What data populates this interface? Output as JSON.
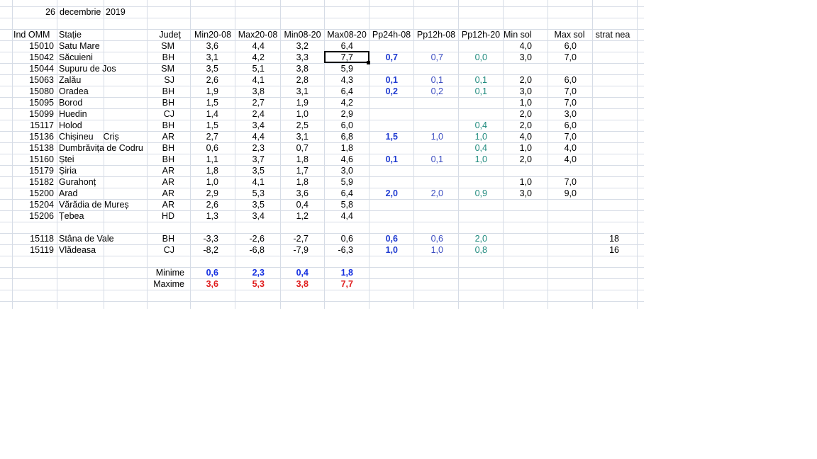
{
  "date": {
    "day": "26",
    "month": "decembrie",
    "year": "2019"
  },
  "headers": [
    "Ind OMM",
    "Stație",
    "Județ",
    "Min20-08",
    "Max20-08",
    "Min08-20",
    "Max08-20",
    "Pp24h-08",
    "Pp12h-08",
    "Pp12h-20",
    "Min sol",
    "Max sol",
    "strat nea"
  ],
  "rows": [
    {
      "id": "15010",
      "station": "Satu Mare",
      "county": "SM",
      "min2008": "3,6",
      "max2008": "4,4",
      "min0820": "3,2",
      "max0820": "6,4",
      "pp24": "",
      "pp12a": "",
      "pp12b": "",
      "minsol": "4,0",
      "maxsol": "6,0",
      "snow": ""
    },
    {
      "id": "15042",
      "station": "Săcuieni",
      "county": "BH",
      "min2008": "3,1",
      "max2008": "4,2",
      "min0820": "3,3",
      "max0820": "7,7",
      "pp24": "0,7",
      "pp12a": "0,7",
      "pp12b": "0,0",
      "minsol": "3,0",
      "maxsol": "7,0",
      "snow": ""
    },
    {
      "id": "15044",
      "station": "Supuru de Jos",
      "county": "SM",
      "min2008": "3,5",
      "max2008": "5,1",
      "min0820": "3,8",
      "max0820": "5,9",
      "pp24": "",
      "pp12a": "",
      "pp12b": "",
      "minsol": "",
      "maxsol": "",
      "snow": ""
    },
    {
      "id": "15063",
      "station": "Zalău",
      "county": "SJ",
      "min2008": "2,6",
      "max2008": "4,1",
      "min0820": "2,8",
      "max0820": "4,3",
      "pp24": "0,1",
      "pp12a": "0,1",
      "pp12b": "0,1",
      "minsol": "2,0",
      "maxsol": "6,0",
      "snow": ""
    },
    {
      "id": "15080",
      "station": "Oradea",
      "county": "BH",
      "min2008": "1,9",
      "max2008": "3,8",
      "min0820": "3,1",
      "max0820": "6,4",
      "pp24": "0,2",
      "pp12a": "0,2",
      "pp12b": "0,1",
      "minsol": "3,0",
      "maxsol": "7,0",
      "snow": ""
    },
    {
      "id": "15095",
      "station": "Borod",
      "county": "BH",
      "min2008": "1,5",
      "max2008": "2,7",
      "min0820": "1,9",
      "max0820": "4,2",
      "pp24": "",
      "pp12a": "",
      "pp12b": "",
      "minsol": "1,0",
      "maxsol": "7,0",
      "snow": ""
    },
    {
      "id": "15099",
      "station": "Huedin",
      "county": "CJ",
      "min2008": "1,4",
      "max2008": "2,4",
      "min0820": "1,0",
      "max0820": "2,9",
      "pp24": "",
      "pp12a": "",
      "pp12b": "",
      "minsol": "2,0",
      "maxsol": "3,0",
      "snow": ""
    },
    {
      "id": "15117",
      "station": "Holod",
      "county": "BH",
      "min2008": "1,5",
      "max2008": "3,4",
      "min0820": "2,5",
      "max0820": "6,0",
      "pp24": "",
      "pp12a": "",
      "pp12b": "0,4",
      "minsol": "2,0",
      "maxsol": "6,0",
      "snow": ""
    },
    {
      "id": "15136",
      "station": "Chișineu    Criș",
      "county": "AR",
      "min2008": "2,7",
      "max2008": "4,4",
      "min0820": "3,1",
      "max0820": "6,8",
      "pp24": "1,5",
      "pp12a": "1,0",
      "pp12b": "1,0",
      "minsol": "4,0",
      "maxsol": "7,0",
      "snow": ""
    },
    {
      "id": "15138",
      "station": "Dumbrăvița de Codru",
      "county": "BH",
      "min2008": "0,6",
      "max2008": "2,3",
      "min0820": "0,7",
      "max0820": "1,8",
      "pp24": "",
      "pp12a": "",
      "pp12b": "0,4",
      "minsol": "1,0",
      "maxsol": "4,0",
      "snow": ""
    },
    {
      "id": "15160",
      "station": "Ștei",
      "county": "BH",
      "min2008": "1,1",
      "max2008": "3,7",
      "min0820": "1,8",
      "max0820": "4,6",
      "pp24": "0,1",
      "pp12a": "0,1",
      "pp12b": "1,0",
      "minsol": "2,0",
      "maxsol": "4,0",
      "snow": ""
    },
    {
      "id": "15179",
      "station": "Șiria",
      "county": "AR",
      "min2008": "1,8",
      "max2008": "3,5",
      "min0820": "1,7",
      "max0820": "3,0",
      "pp24": "",
      "pp12a": "",
      "pp12b": "",
      "minsol": "",
      "maxsol": "",
      "snow": ""
    },
    {
      "id": "15182",
      "station": "Gurahonț",
      "county": "AR",
      "min2008": "1,0",
      "max2008": "4,1",
      "min0820": "1,8",
      "max0820": "5,9",
      "pp24": "",
      "pp12a": "",
      "pp12b": "",
      "minsol": "1,0",
      "maxsol": "7,0",
      "snow": ""
    },
    {
      "id": "15200",
      "station": "Arad",
      "county": "AR",
      "min2008": "2,9",
      "max2008": "5,3",
      "min0820": "3,6",
      "max0820": "6,4",
      "pp24": "2,0",
      "pp12a": "2,0",
      "pp12b": "0,9",
      "minsol": "3,0",
      "maxsol": "9,0",
      "snow": ""
    },
    {
      "id": "15204",
      "station": "Vărădia de Mureș",
      "county": "AR",
      "min2008": "2,6",
      "max2008": "3,5",
      "min0820": "0,4",
      "max0820": "5,8",
      "pp24": "",
      "pp12a": "",
      "pp12b": "",
      "minsol": "",
      "maxsol": "",
      "snow": ""
    },
    {
      "id": "15206",
      "station": "Țebea",
      "county": "HD",
      "min2008": "1,3",
      "max2008": "3,4",
      "min0820": "1,2",
      "max0820": "4,4",
      "pp24": "",
      "pp12a": "",
      "pp12b": "",
      "minsol": "",
      "maxsol": "",
      "snow": ""
    }
  ],
  "mountain_rows": [
    {
      "id": "15118",
      "station": "Stâna de Vale",
      "county": "BH",
      "min2008": "-3,3",
      "max2008": "-2,6",
      "min0820": "-2,7",
      "max0820": "0,6",
      "pp24": "0,6",
      "pp12a": "0,6",
      "pp12b": "2,0",
      "minsol": "",
      "maxsol": "",
      "snow": "18"
    },
    {
      "id": "15119",
      "station": "Vlădeasa",
      "county": "CJ",
      "min2008": "-8,2",
      "max2008": "-6,8",
      "min0820": "-7,9",
      "max0820": "-6,3",
      "pp24": "1,0",
      "pp12a": "1,0",
      "pp12b": "0,8",
      "minsol": "",
      "maxsol": "",
      "snow": "16"
    }
  ],
  "summary": {
    "min_label": "Minime",
    "max_label": "Maxime",
    "minime": [
      "0,6",
      "2,3",
      "0,4",
      "1,8"
    ],
    "maxime": [
      "3,6",
      "5,3",
      "3,8",
      "7,7"
    ]
  },
  "colors": {
    "grid": "#d6dce6",
    "pp24": "#1f3bd1",
    "pp12h08": "#3a4cc0",
    "pp12h20": "#1f8a7e",
    "minime": "#1530e0",
    "maxime": "#e01d1d"
  }
}
